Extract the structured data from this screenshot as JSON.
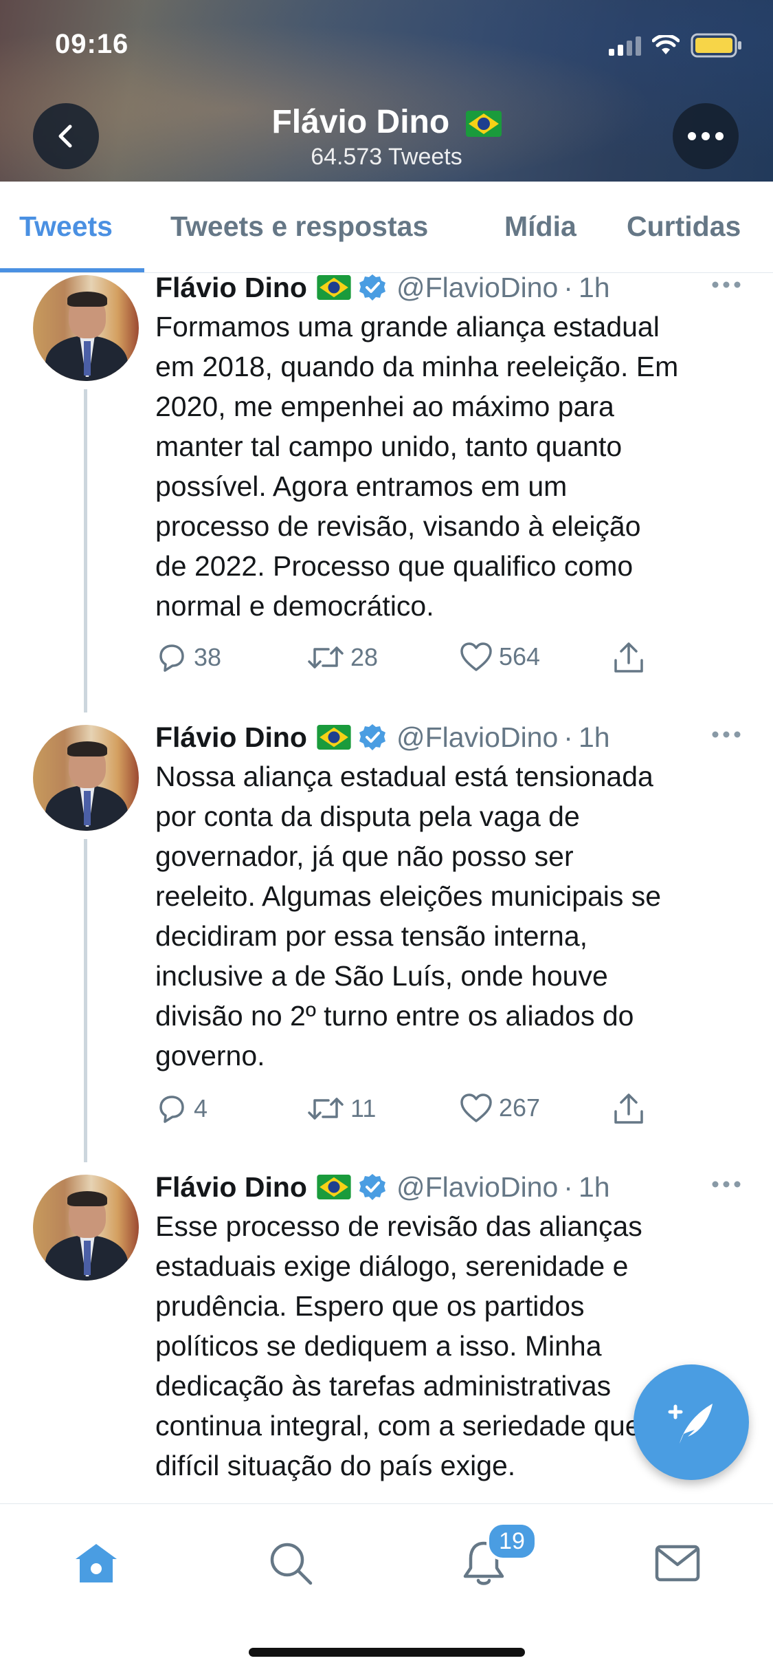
{
  "status_bar": {
    "time": "09:16"
  },
  "profile": {
    "name": "Flávio Dino",
    "tweet_count": "64.573 Tweets"
  },
  "tabs": [
    {
      "label": "Tweets",
      "active": true
    },
    {
      "label": "Tweets e respostas",
      "active": false
    },
    {
      "label": "Mídia",
      "active": false
    },
    {
      "label": "Curtidas",
      "active": false
    }
  ],
  "tweets": [
    {
      "name": "Flávio Dino",
      "handle": "@FlavioDino",
      "time": "1h",
      "text": "Formamos uma grande aliança estadual\nem 2018, quando da minha reeleição. Em\n2020, me empenhei ao máximo para\nmanter tal campo unido, tanto quanto\npossível. Agora entramos em um\nprocesso de revisão, visando à eleição\nde 2022. Processo que qualifico como\nnormal e democrático.",
      "replies": "38",
      "retweets": "28",
      "likes": "564"
    },
    {
      "name": "Flávio Dino",
      "handle": "@FlavioDino",
      "time": "1h",
      "text": "Nossa aliança estadual está tensionada\npor conta da disputa pela vaga de\ngovernador, já que não posso ser\nreeleito. Algumas eleições municipais se\ndecidiram por essa tensão interna,\ninclusive a de São Luís, onde houve\ndivisão no 2º turno entre os aliados do\ngoverno.",
      "replies": "4",
      "retweets": "11",
      "likes": "267"
    },
    {
      "name": "Flávio Dino",
      "handle": "@FlavioDino",
      "time": "1h",
      "text": "Esse processo de revisão das alianças\nestaduais exige diálogo, serenidade e\nprudência. Espero que os partidos\npolíticos se dediquem a isso. Minha\ndedicação às tarefas administrativas\ncontinua integral, com a seriedade que a\ndifícil situação do país exige.",
      "replies": "",
      "retweets": "",
      "likes": ""
    }
  ],
  "icons": {
    "back": "chevron-left-icon",
    "more": "more-horizontal-icon",
    "verified": "verified-badge-icon",
    "flag": "brazil-flag-icon",
    "reply": "reply-icon",
    "retweet": "retweet-icon",
    "like": "heart-icon",
    "share": "share-icon",
    "compose": "compose-tweet-icon",
    "home": "home-icon",
    "search": "search-icon",
    "notifications": "bell-icon",
    "messages": "mail-icon"
  },
  "notifications_badge": "19",
  "colors": {
    "accent": "#4a90e2",
    "muted": "#657786",
    "text": "#14171a",
    "divider": "#ccd6dd"
  }
}
